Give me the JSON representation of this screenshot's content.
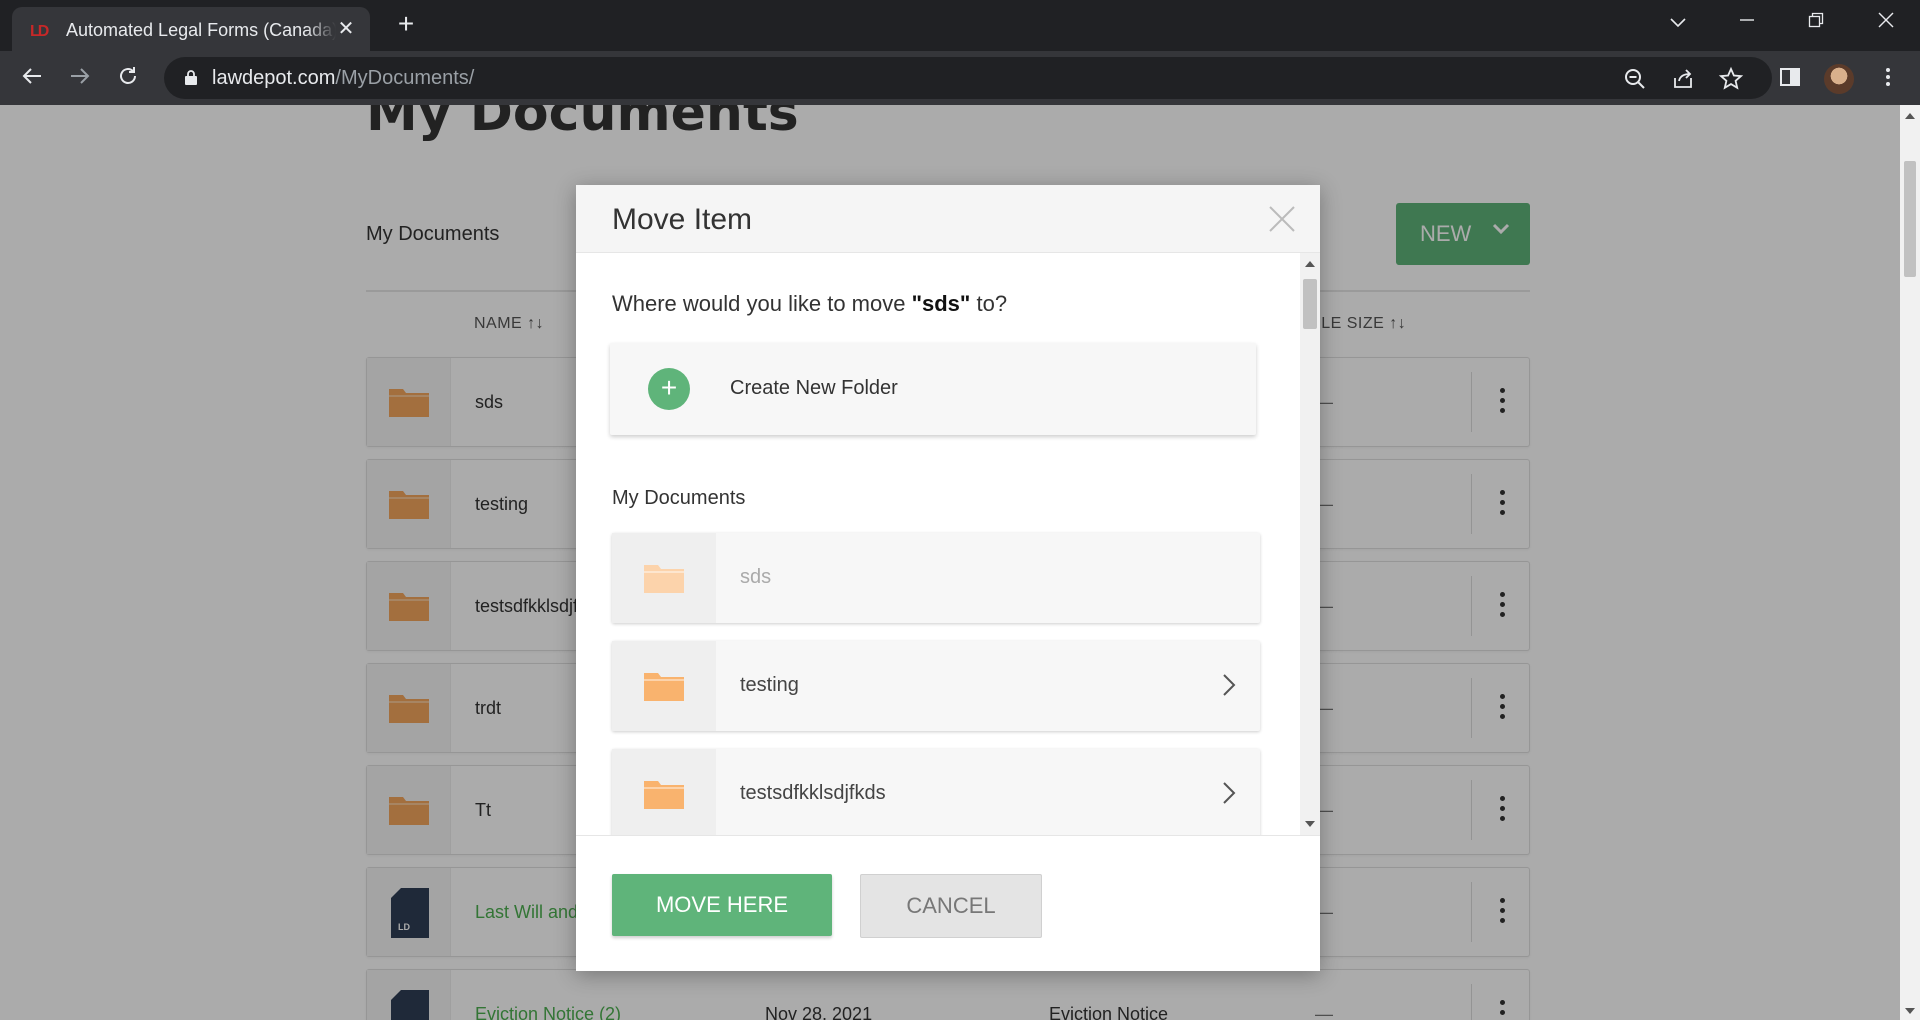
{
  "browser": {
    "tab_title": "Automated Legal Forms (Canada)",
    "favicon_text": "LD",
    "url_host": "lawdepot.com",
    "url_path": "/MyDocuments/"
  },
  "page": {
    "title": "My Documents",
    "breadcrumb": "My Documents",
    "new_button": "NEW",
    "col_name": "NAME ↑↓",
    "col_size": "FILE SIZE ↑↓",
    "rows": [
      {
        "name": "sds",
        "kind": "folder",
        "size": "—"
      },
      {
        "name": "testing",
        "kind": "folder",
        "size": "—"
      },
      {
        "name": "testsdfkklsdjfkds",
        "kind": "folder",
        "size": "—"
      },
      {
        "name": "trdt",
        "kind": "folder",
        "size": "—"
      },
      {
        "name": "Tt",
        "kind": "folder",
        "size": "—"
      },
      {
        "name": "Last Will and Testament",
        "kind": "document",
        "size": "—"
      },
      {
        "name": "Eviction Notice (2)",
        "kind": "document",
        "date": "Nov 28, 2021",
        "type": "Eviction Notice",
        "size": "—"
      }
    ]
  },
  "modal": {
    "title": "Move Item",
    "question_prefix": "Where would you like to move ",
    "item_name": "\"sds\"",
    "question_suffix": " to?",
    "create_folder": "Create New Folder",
    "section_label": "My Documents",
    "folders": [
      {
        "name": "sds",
        "disabled": true
      },
      {
        "name": "testing",
        "disabled": false
      },
      {
        "name": "testsdfkklsdjfkds",
        "disabled": false
      }
    ],
    "move_button": "MOVE HERE",
    "cancel_button": "CANCEL"
  },
  "colors": {
    "accent_green": "#5fb47a",
    "folder_orange": "#f4a65d",
    "chrome_dark": "#202124"
  }
}
